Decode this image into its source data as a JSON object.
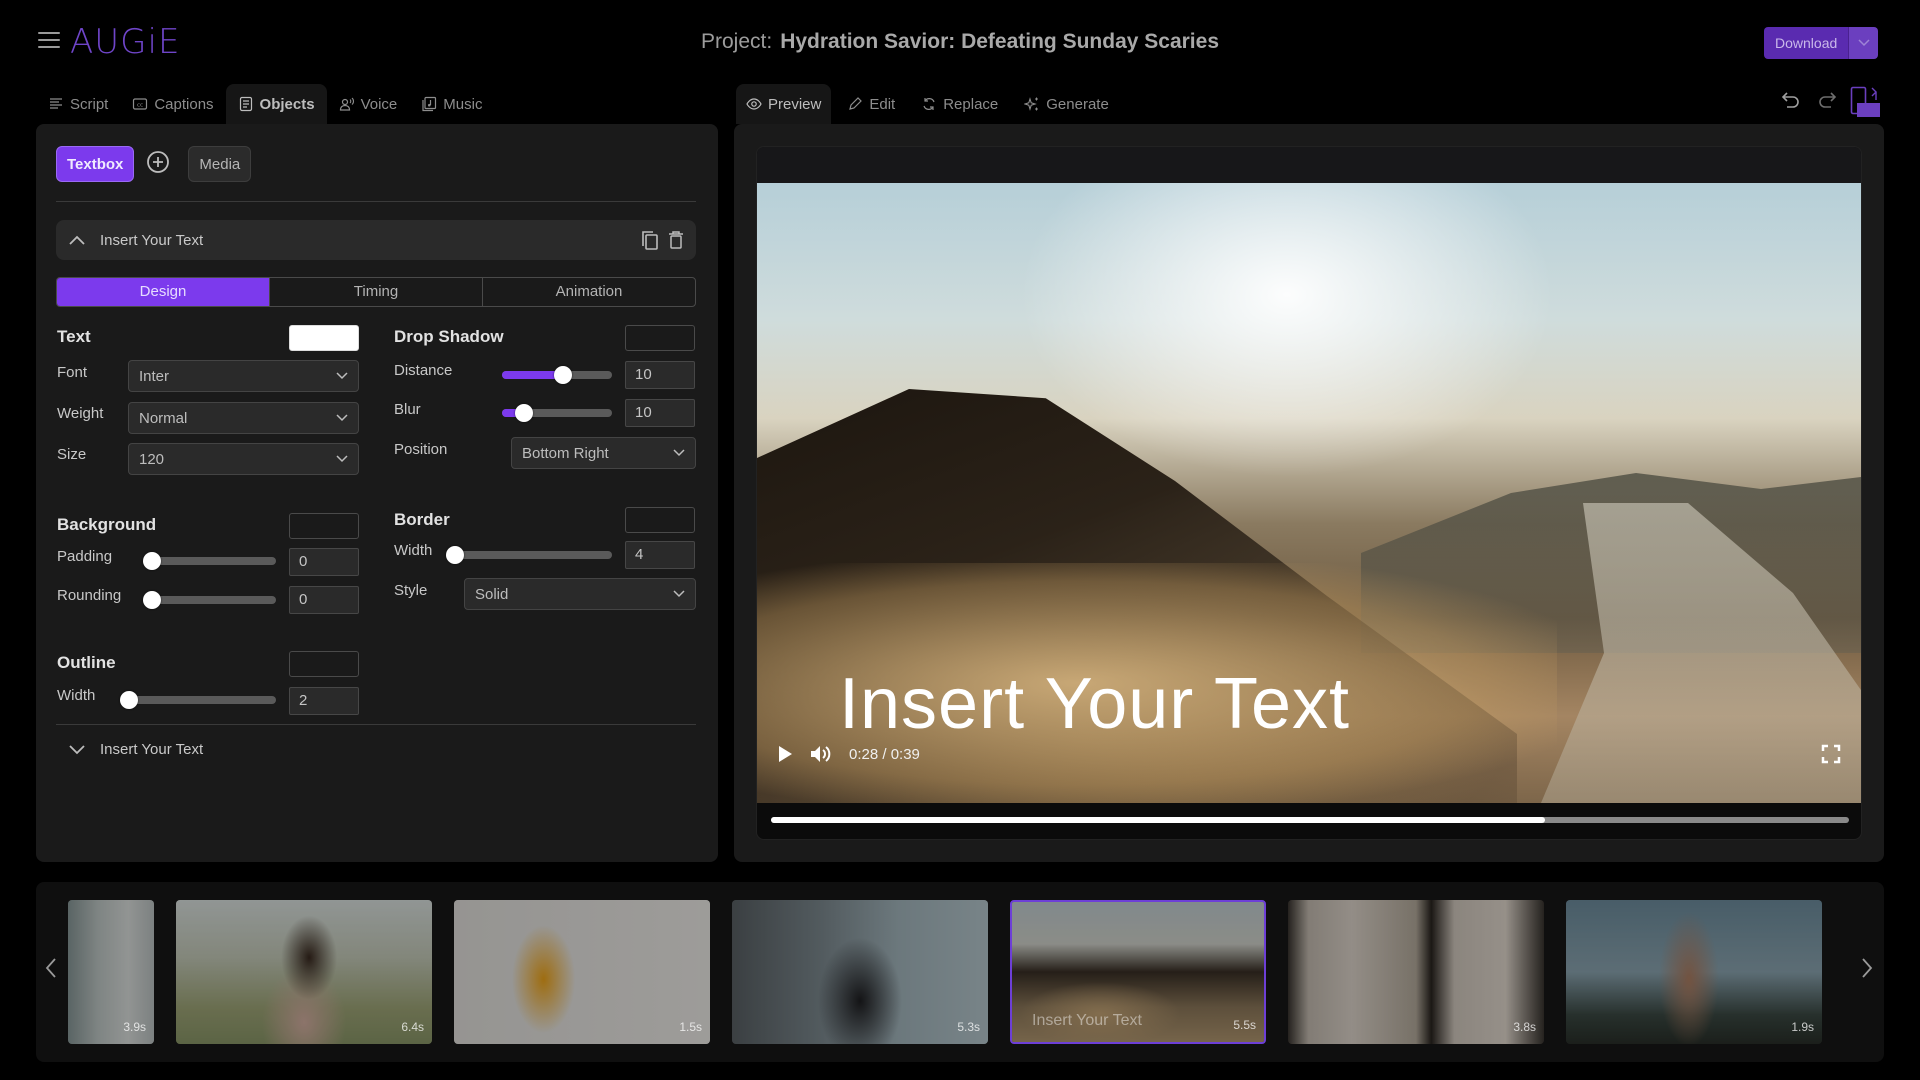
{
  "app": {
    "logo": "AUGiE",
    "project_label": "Project:",
    "project_name": "Hydration Savior: Defeating Sunday Scaries",
    "download_label": "Download",
    "accent_color": "#7c3aed"
  },
  "left_tabs": [
    {
      "label": "Script",
      "icon": "script-lines-icon",
      "active": false
    },
    {
      "label": "Captions",
      "icon": "captions-cc-icon",
      "active": false
    },
    {
      "label": "Objects",
      "icon": "objects-doc-icon",
      "active": true
    },
    {
      "label": "Voice",
      "icon": "voice-person-icon",
      "active": false
    },
    {
      "label": "Music",
      "icon": "music-note-icon",
      "active": false
    }
  ],
  "right_tabs": [
    {
      "label": "Preview",
      "icon": "eye-icon",
      "active": true
    },
    {
      "label": "Edit",
      "icon": "pencil-icon",
      "active": false
    },
    {
      "label": "Replace",
      "icon": "refresh-icon",
      "active": false
    },
    {
      "label": "Generate",
      "icon": "sparkle-icon",
      "active": false
    }
  ],
  "objects_panel": {
    "type_buttons": {
      "textbox": "Textbox",
      "media": "Media"
    },
    "expanded_object": {
      "title": "Insert Your Text",
      "subtabs": [
        "Design",
        "Timing",
        "Animation"
      ],
      "active_subtab": "Design",
      "text": {
        "section": "Text",
        "color": "#ffffff",
        "font_label": "Font",
        "font_value": "Inter",
        "weight_label": "Weight",
        "weight_value": "Normal",
        "size_label": "Size",
        "size_value": "120"
      },
      "drop_shadow": {
        "section": "Drop Shadow",
        "distance_label": "Distance",
        "distance_value": "10",
        "distance_slider_pct": 55,
        "blur_label": "Blur",
        "blur_value": "10",
        "blur_slider_pct": 20,
        "position_label": "Position",
        "position_value": "Bottom Right"
      },
      "background": {
        "section": "Background",
        "padding_label": "Padding",
        "padding_value": "0",
        "padding_slider_pct": 0,
        "rounding_label": "Rounding",
        "rounding_value": "0",
        "rounding_slider_pct": 0
      },
      "border": {
        "section": "Border",
        "width_label": "Width",
        "width_value": "4",
        "width_slider_pct": 0,
        "style_label": "Style",
        "style_value": "Solid"
      },
      "outline": {
        "section": "Outline",
        "width_label": "Width",
        "width_value": "2",
        "width_slider_pct": 0
      }
    },
    "collapsed_object": {
      "title": "Insert Your Text"
    }
  },
  "preview": {
    "overlay_text": "Insert Your Text",
    "time": "0:28 / 0:39",
    "progress_pct": 71.8
  },
  "timeline": {
    "clips": [
      {
        "duration": "3.9s",
        "scene": "water-glass",
        "selected": false,
        "caption": ""
      },
      {
        "duration": "6.4s",
        "scene": "woman-outdoors",
        "selected": false,
        "caption": ""
      },
      {
        "duration": "1.5s",
        "scene": "orange-juice",
        "selected": false,
        "caption": ""
      },
      {
        "duration": "5.3s",
        "scene": "woman-drink-building",
        "selected": false,
        "caption": ""
      },
      {
        "duration": "5.5s",
        "scene": "foggy-valley",
        "selected": true,
        "caption": "Insert Your Text"
      },
      {
        "duration": "3.8s",
        "scene": "curtains",
        "selected": false,
        "caption": ""
      },
      {
        "duration": "1.9s",
        "scene": "woman-bridge",
        "selected": false,
        "caption": ""
      }
    ]
  }
}
